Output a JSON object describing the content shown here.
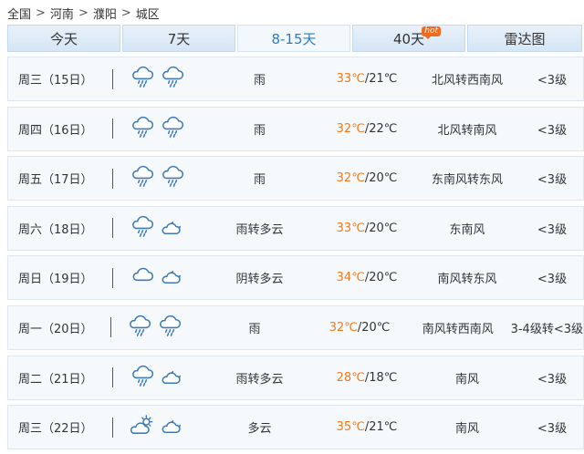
{
  "breadcrumb": [
    "全国",
    "河南",
    "濮阳",
    "城区"
  ],
  "tabs": [
    {
      "label": "今天",
      "width": 124
    },
    {
      "label": "7天",
      "width": 124
    },
    {
      "label": "8-15天",
      "width": 124,
      "active": true
    },
    {
      "label": "40天",
      "width": 124,
      "badge": "hot"
    },
    {
      "label": "雷达图",
      "width": 124
    }
  ],
  "forecast": [
    {
      "date": "周三（15日）",
      "icons": [
        "rain-icon",
        "rain-icon"
      ],
      "desc": "雨",
      "high": "33℃",
      "low": "/21℃",
      "wind": "北风转西南风",
      "level": "<3级"
    },
    {
      "date": "周四（16日）",
      "icons": [
        "rain-icon",
        "rain-icon"
      ],
      "desc": "雨",
      "high": "32℃",
      "low": "/22℃",
      "wind": "北风转南风",
      "level": "<3级"
    },
    {
      "date": "周五（17日）",
      "icons": [
        "rain-icon",
        "rain-icon"
      ],
      "desc": "雨",
      "high": "32℃",
      "low": "/20℃",
      "wind": "东南风转东风",
      "level": "<3级"
    },
    {
      "date": "周六（18日）",
      "icons": [
        "rain-icon",
        "cloudy-night-icon"
      ],
      "desc": "雨转多云",
      "high": "33℃",
      "low": "/20℃",
      "wind": "东南风",
      "level": "<3级"
    },
    {
      "date": "周日（19日）",
      "icons": [
        "overcast-icon",
        "cloudy-night-icon"
      ],
      "desc": "阴转多云",
      "high": "34℃",
      "low": "/20℃",
      "wind": "南风转东风",
      "level": "<3级"
    },
    {
      "date": "周一（20日）",
      "icons": [
        "rain-icon",
        "rain-icon"
      ],
      "desc": "雨",
      "high": "32℃",
      "low": "/20℃",
      "wind": "南风转西南风",
      "level": "3-4级转<3级"
    },
    {
      "date": "周二（21日）",
      "icons": [
        "rain-icon",
        "cloudy-night-icon"
      ],
      "desc": "雨转多云",
      "high": "28℃",
      "low": "/18℃",
      "wind": "南风",
      "level": "<3级"
    },
    {
      "date": "周三（22日）",
      "icons": [
        "partly-cloudy-day-icon",
        "cloudy-night-icon"
      ],
      "desc": "多云",
      "high": "35℃",
      "low": "/21℃",
      "wind": "南风",
      "level": "<3级"
    }
  ],
  "colors": {
    "icon_stroke": "#3d7ab8",
    "high_temp": "#f27a1a",
    "active_tab": "#2b7bc4"
  }
}
